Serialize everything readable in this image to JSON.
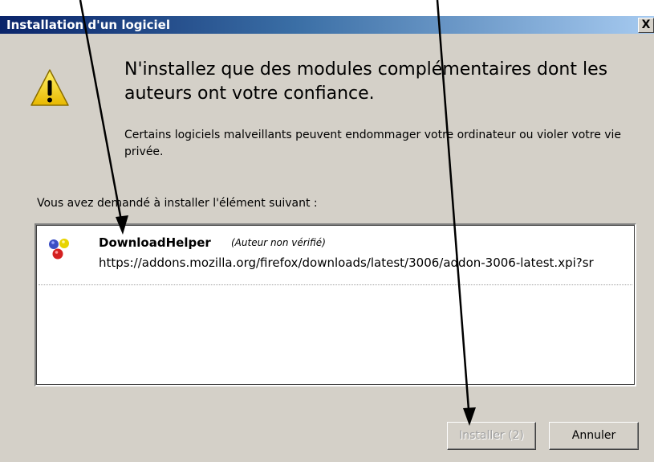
{
  "window": {
    "title": "Installation d'un logiciel",
    "close_label": "X"
  },
  "warning": {
    "headline": "N'installez que des modules complémentaires dont les auteurs ont votre confiance.",
    "body": "Certains logiciels malveillants peuvent endommager votre ordinateur ou violer votre vie privée."
  },
  "request_label": "Vous avez demandé à installer l'élément suivant :",
  "addon": {
    "name": "DownloadHelper",
    "author": "(Auteur non vérifié)",
    "url": "https://addons.mozilla.org/firefox/downloads/latest/3006/addon-3006-latest.xpi?sr"
  },
  "buttons": {
    "install": "Installer (2)",
    "cancel": "Annuler",
    "install_enabled": false
  },
  "colors": {
    "titlebar_start": "#0a246a",
    "titlebar_end": "#a6caf0",
    "dialog_bg": "#d4d0c8",
    "warning_yellow": "#f5d000"
  },
  "icons": {
    "warning": "warning-triangle-icon",
    "addon": "molecule-icon",
    "close": "close-icon"
  }
}
